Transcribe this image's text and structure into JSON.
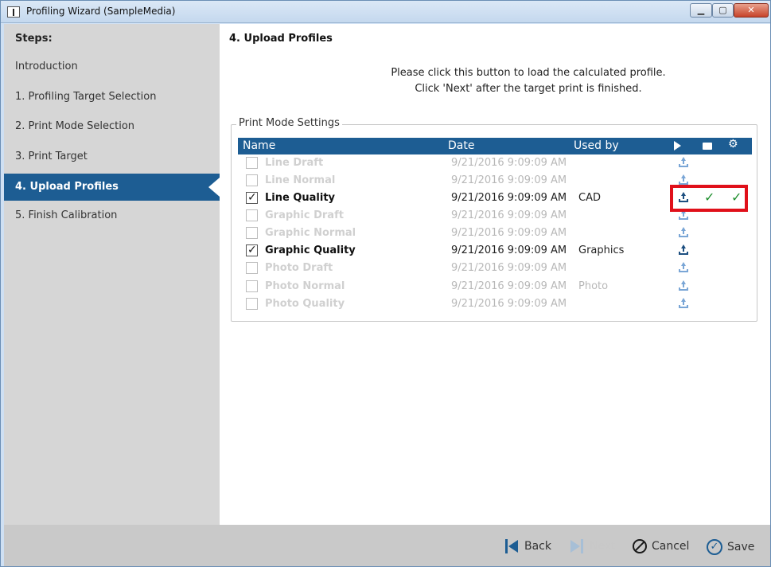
{
  "window": {
    "title": "Profiling Wizard (SampleMedia)",
    "min_label": "▁",
    "max_label": "▢",
    "close_label": "✕"
  },
  "sidebar": {
    "heading": "Steps:",
    "items": [
      {
        "label": "Introduction"
      },
      {
        "label": "1. Profiling Target Selection"
      },
      {
        "label": "2. Print Mode Selection"
      },
      {
        "label": "3. Print Target"
      },
      {
        "label": "4. Upload Profiles",
        "active": true
      },
      {
        "label": "5. Finish Calibration"
      }
    ]
  },
  "main": {
    "title": "4. Upload Profiles",
    "instruction_1": "Please click this button to load the calculated profile.",
    "instruction_2": "Click 'Next' after the target print is finished.",
    "group_label": "Print Mode Settings",
    "columns": {
      "name": "Name",
      "date": "Date",
      "used_by": "Used by",
      "gear_glyph": "⚙"
    },
    "rows": [
      {
        "name": "Line Draft",
        "date": "9/21/2016 9:09:09 AM",
        "used_by": "",
        "checked": false
      },
      {
        "name": "Line Normal",
        "date": "9/21/2016 9:09:09 AM",
        "used_by": "",
        "checked": false
      },
      {
        "name": "Line Quality",
        "date": "9/21/2016 9:09:09 AM",
        "used_by": "CAD",
        "checked": true,
        "check1": "✓",
        "check2": "✓"
      },
      {
        "name": "Graphic Draft",
        "date": "9/21/2016 9:09:09 AM",
        "used_by": "",
        "checked": false
      },
      {
        "name": "Graphic Normal",
        "date": "9/21/2016 9:09:09 AM",
        "used_by": "",
        "checked": false
      },
      {
        "name": "Graphic Quality",
        "date": "9/21/2016 9:09:09 AM",
        "used_by": "Graphics",
        "checked": true
      },
      {
        "name": "Photo Draft",
        "date": "9/21/2016 9:09:09 AM",
        "used_by": "",
        "checked": false
      },
      {
        "name": "Photo Normal",
        "date": "9/21/2016 9:09:09 AM",
        "used_by": "Photo",
        "checked": false
      },
      {
        "name": "Photo Quality",
        "date": "9/21/2016 9:09:09 AM",
        "used_by": "",
        "checked": false
      }
    ]
  },
  "footer": {
    "back": "Back",
    "next": "Next",
    "cancel": "Cancel",
    "save": "Save",
    "save_glyph": "✓"
  },
  "colors": {
    "accent": "#1d5d93",
    "highlight": "#e0101a",
    "check": "#1f8f2e"
  }
}
